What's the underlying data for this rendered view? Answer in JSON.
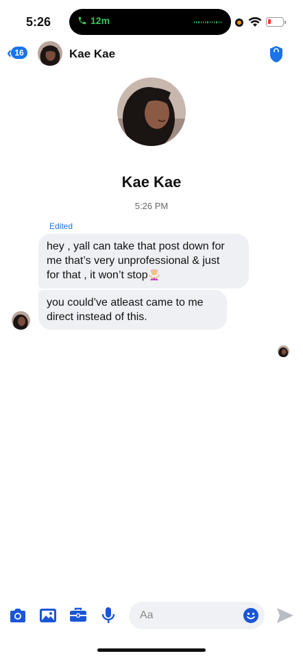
{
  "status_bar": {
    "time": "5:26",
    "call_duration": "12m",
    "call_color": "#34c759"
  },
  "header": {
    "back_badge": "16",
    "contact_name": "Kae Kae",
    "accent_color": "#1a73e8"
  },
  "profile": {
    "name": "Kae Kae",
    "timestamp": "5:26 PM"
  },
  "thread": {
    "edited_label": "Edited",
    "messages": [
      {
        "lines": [
          "hey , yall can take that post down for",
          "me that’s very unprofessional & just",
          "for that , it won’t stop"
        ],
        "emoji": "person-gesturing-no-emoji"
      },
      {
        "lines": [
          "you could’ve atleast came to me",
          "direct instead of this."
        ]
      }
    ]
  },
  "composer": {
    "placeholder": "Aa",
    "tools": [
      "camera-icon",
      "photo-icon",
      "briefcase-icon",
      "microphone-icon"
    ],
    "emoji_icon": "smiley-icon",
    "send_icon": "send-arrow-icon"
  }
}
